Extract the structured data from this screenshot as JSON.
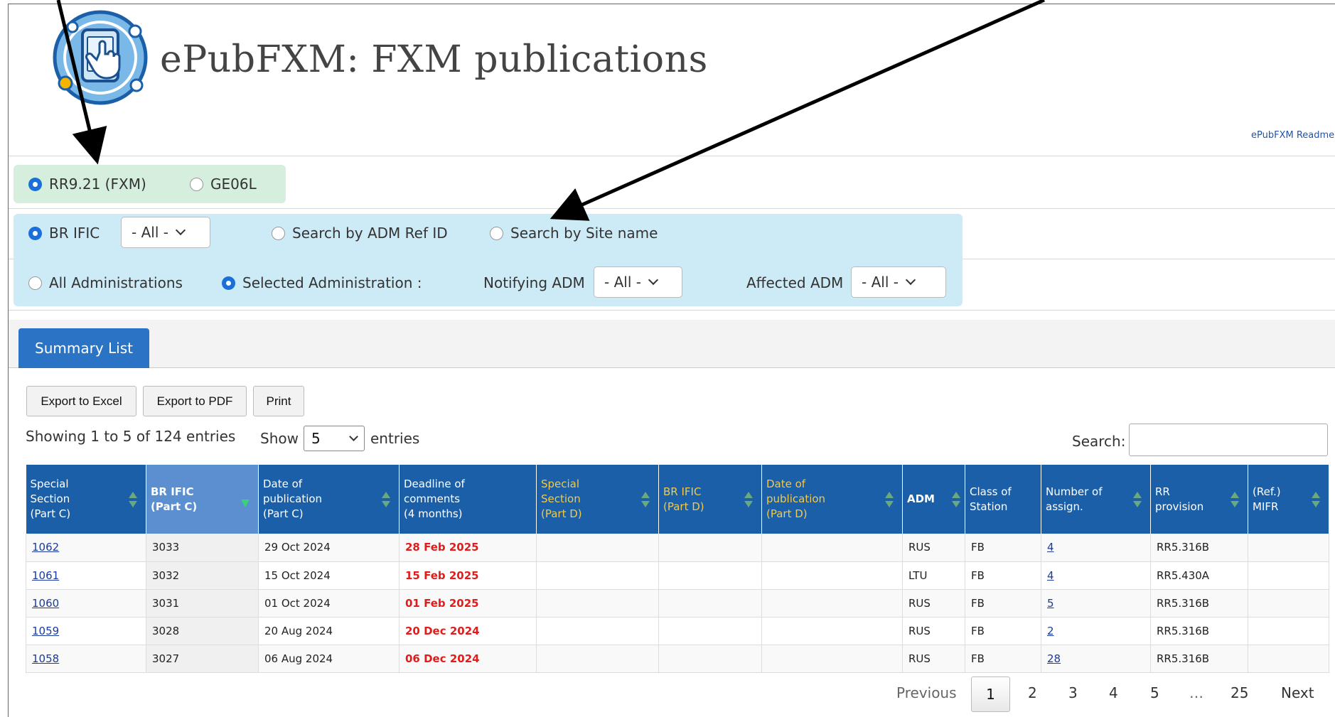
{
  "header": {
    "title": "ePubFXM: FXM publications",
    "readme_link": "ePubFXM Readme"
  },
  "filters": {
    "mode": [
      {
        "label": "RR9.21 (FXM)",
        "selected": true
      },
      {
        "label": "GE06L",
        "selected": false
      }
    ],
    "search": {
      "br_ific": {
        "label": "BR IFIC",
        "selected": true,
        "value": "- All -"
      },
      "adm_ref": {
        "label": "Search by ADM Ref ID",
        "selected": false
      },
      "site_name": {
        "label": "Search by Site name",
        "selected": false
      }
    },
    "administration": {
      "all_label": "All Administrations",
      "selected_label": "Selected Administration :",
      "notifying_label": "Notifying ADM",
      "notifying_value": "- All -",
      "affected_label": "Affected ADM",
      "affected_value": "- All -"
    }
  },
  "tabs": [
    {
      "label": "Summary List",
      "active": true
    }
  ],
  "toolbar": {
    "export_excel": "Export to Excel",
    "export_pdf": "Export to PDF",
    "print": "Print"
  },
  "list": {
    "info": "Showing 1 to 5 of 124 entries",
    "show_label": "Show",
    "page_size": "5",
    "entries_label": "entries",
    "search_label": "Search:",
    "search_value": ""
  },
  "table": {
    "columns": [
      [
        "Special",
        "Section",
        "(Part C)"
      ],
      [
        "BR IFIC",
        "(Part C)"
      ],
      [
        "Date of",
        "publication",
        "(Part C)"
      ],
      [
        "Deadline of",
        "comments",
        "(4 months)"
      ],
      [
        "Special",
        "Section",
        "(Part D)"
      ],
      [
        "BR IFIC",
        "(Part D)"
      ],
      [
        "Date of",
        "publication",
        "(Part D)"
      ],
      [
        "ADM"
      ],
      [
        "Class of",
        "Station"
      ],
      [
        "Number of",
        "assign."
      ],
      [
        "RR",
        "provision"
      ],
      [
        "(Ref.)",
        "MIFR"
      ]
    ],
    "rows": [
      [
        "1062",
        "3033",
        "29 Oct 2024",
        "28 Feb 2025",
        "",
        "",
        "",
        "RUS",
        "FB",
        "4",
        "RR5.316B",
        ""
      ],
      [
        "1061",
        "3032",
        "15 Oct 2024",
        "15 Feb 2025",
        "",
        "",
        "",
        "LTU",
        "FB",
        "4",
        "RR5.430A",
        ""
      ],
      [
        "1060",
        "3031",
        "01 Oct 2024",
        "01 Feb 2025",
        "",
        "",
        "",
        "RUS",
        "FB",
        "5",
        "RR5.316B",
        ""
      ],
      [
        "1059",
        "3028",
        "20 Aug 2024",
        "20 Dec 2024",
        "",
        "",
        "",
        "RUS",
        "FB",
        "2",
        "RR5.316B",
        ""
      ],
      [
        "1058",
        "3027",
        "06 Aug 2024",
        "06 Dec 2024",
        "",
        "",
        "",
        "RUS",
        "FB",
        "28",
        "RR5.316B",
        ""
      ]
    ]
  },
  "pagination": {
    "previous": "Previous",
    "pages": [
      "1",
      "2",
      "3",
      "4",
      "5"
    ],
    "ellipsis": "…",
    "last": "25",
    "next": "Next",
    "current": "1"
  },
  "colors": {
    "header_blue": "#1a5fa8",
    "tab_blue": "#2b73c4",
    "deadline_red": "#e21b1b",
    "panel_green": "#d5eedd",
    "panel_blue": "#cdebf7"
  }
}
